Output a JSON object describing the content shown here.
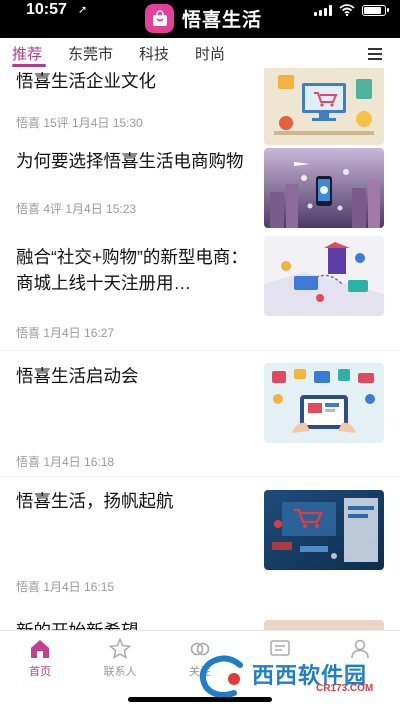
{
  "status_bar": {
    "time": "10:57"
  },
  "header": {
    "app_name": "悟喜生活",
    "brand_color": "#e3409a"
  },
  "tabs": [
    {
      "label": "推荐",
      "active": true
    },
    {
      "label": "东莞市",
      "active": false
    },
    {
      "label": "科技",
      "active": false
    },
    {
      "label": "时尚",
      "active": false
    }
  ],
  "accent_color": "#b23c8f",
  "articles": [
    {
      "title": "悟喜生活企业文化",
      "meta": "悟喜 15评 1月4日 15:30"
    },
    {
      "title": "为何要选择悟喜生活电商购物",
      "meta": "悟喜 4评 1月4日 15:23"
    },
    {
      "title": "融合“社交+购物”的新型电商：商城上线十天注册用…",
      "meta": "悟喜 1月4日 16:27"
    },
    {
      "title": "悟喜生活启动会",
      "meta": "悟喜 1月4日 16:18"
    },
    {
      "title": "悟喜生活，扬帆起航",
      "meta": "悟喜 1月4日 16:15"
    },
    {
      "title": "新的开始新希望",
      "meta": ""
    }
  ],
  "bottom_nav": [
    {
      "label": "首页",
      "icon": "home-icon",
      "active": true
    },
    {
      "label": "联系人",
      "icon": "star-icon",
      "active": false
    },
    {
      "label": "关注",
      "icon": "rings-icon",
      "active": false
    },
    {
      "label": "",
      "icon": "message-icon",
      "active": false
    },
    {
      "label": "",
      "icon": "person-icon",
      "active": false
    }
  ],
  "watermark": {
    "text": "西西软件园",
    "sub": "CR173.COM"
  }
}
